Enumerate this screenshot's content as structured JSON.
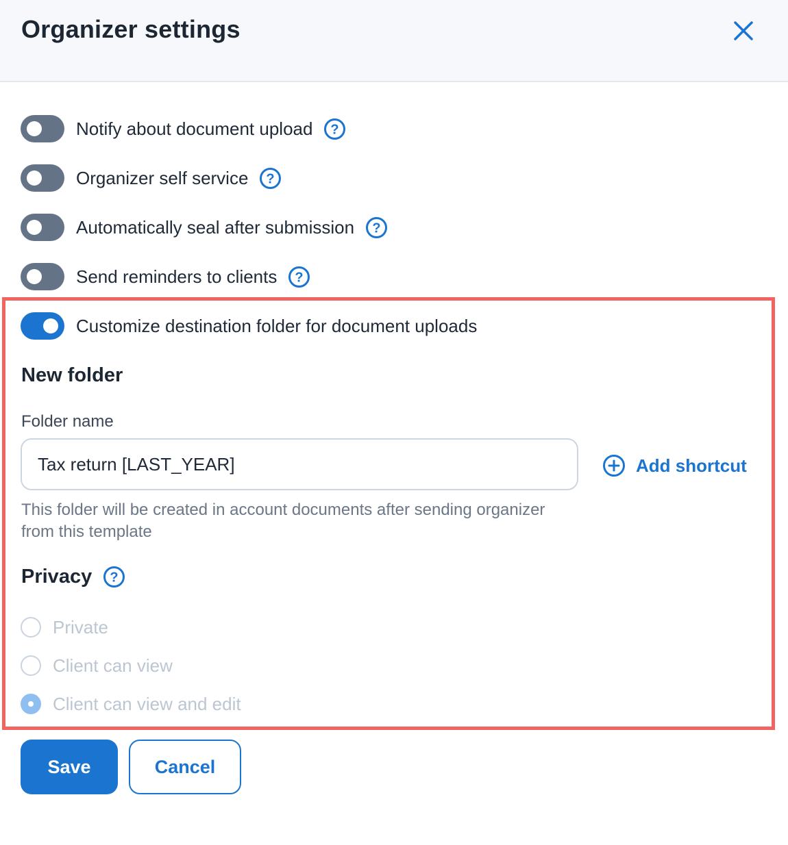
{
  "dialog": {
    "title": "Organizer settings",
    "close_icon": "close-icon"
  },
  "toggles": [
    {
      "label": "Notify about document upload",
      "on": false,
      "help": true
    },
    {
      "label": "Organizer self service",
      "on": false,
      "help": true
    },
    {
      "label": "Automatically seal after submission",
      "on": false,
      "help": true
    },
    {
      "label": "Send reminders to clients",
      "on": false,
      "help": true
    },
    {
      "label": "Customize destination folder for document uploads",
      "on": true,
      "help": false
    }
  ],
  "new_folder": {
    "heading": "New folder",
    "field_label": "Folder name",
    "value": "Tax return [LAST_YEAR]",
    "add_shortcut_label": "Add shortcut",
    "hint": "This folder will be created in account documents after sending organizer from this template"
  },
  "privacy": {
    "heading": "Privacy",
    "options": [
      {
        "label": "Private",
        "selected": false
      },
      {
        "label": "Client can view",
        "selected": false
      },
      {
        "label": "Client can view and edit",
        "selected": true
      }
    ]
  },
  "actions": {
    "save_label": "Save",
    "cancel_label": "Cancel"
  },
  "colors": {
    "accent": "#1b75d0",
    "toggle_off": "#657387",
    "highlight": "#f2645f"
  }
}
